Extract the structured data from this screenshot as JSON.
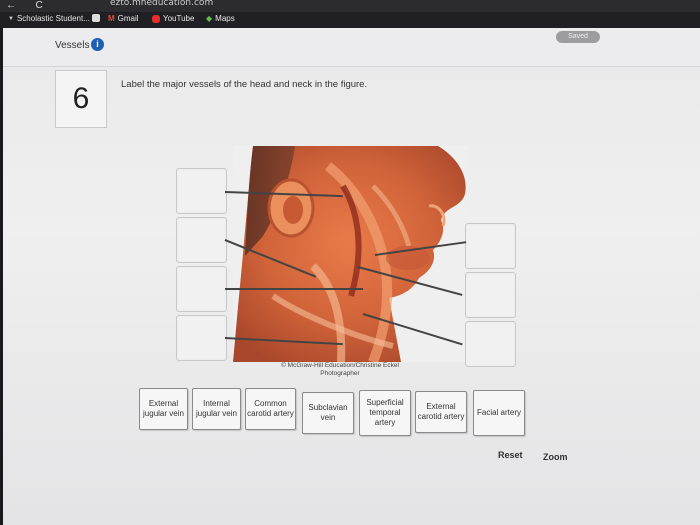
{
  "browser": {
    "url": "ezto.mheducation.com",
    "bookmarks": [
      {
        "label": "Scholastic Student..."
      },
      {
        "label": "Gmail"
      },
      {
        "label": "YouTube"
      },
      {
        "label": "Maps"
      }
    ]
  },
  "header": {
    "title": "Vessels",
    "info_icon": "i",
    "status": "Saved"
  },
  "question": {
    "number": "6",
    "prompt": "Label the major vessels of the head and neck in the figure."
  },
  "figure": {
    "caption": "© McGraw-Hill Education/Christine Eckel Photographer"
  },
  "labels": [
    "External jugular vein",
    "Internal jugular vein",
    "Common carotid artery",
    "Subclavian vein",
    "Superficial temporal artery",
    "External carotid artery",
    "Facial artery"
  ],
  "controls": {
    "reset": "Reset",
    "zoom": "Zoom"
  },
  "colors": {
    "info_icon": "#1e5fb4",
    "saved_badge": "#9d9d9f"
  }
}
